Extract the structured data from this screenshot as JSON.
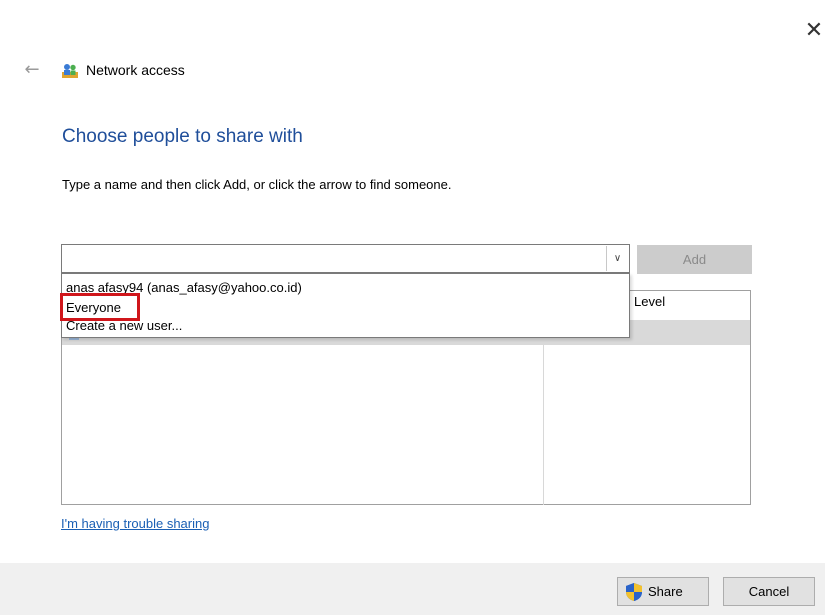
{
  "window": {
    "title": "Network access",
    "close_glyph": "✕",
    "back_glyph": "←"
  },
  "main": {
    "heading": "Choose people to share with",
    "instruction": "Type a name and then click Add, or click the arrow to find someone."
  },
  "name_combo": {
    "value": "",
    "arrow_glyph": "∨"
  },
  "add_button": {
    "label": "Add",
    "enabled": false
  },
  "dropdown": {
    "items": [
      "anas afasy94 (anas_afasy@yahoo.co.id)",
      "Everyone",
      "Create a new user..."
    ],
    "highlighted_item": "Everyone",
    "highlight_color": "#d0161b"
  },
  "table": {
    "permission_header": "Level"
  },
  "links": {
    "trouble": "I'm having trouble sharing"
  },
  "footer": {
    "share_label": "Share",
    "cancel_label": "Cancel"
  },
  "colors": {
    "heading": "#1f4e9a",
    "link": "#1a5fb4",
    "selected_row": "#d9d9d9",
    "footer_bg": "#f0f0f0"
  },
  "icons": [
    "close-icon",
    "back-arrow-icon",
    "network-people-icon",
    "user-icon",
    "uac-shield-icon",
    "chevron-down-icon"
  ]
}
